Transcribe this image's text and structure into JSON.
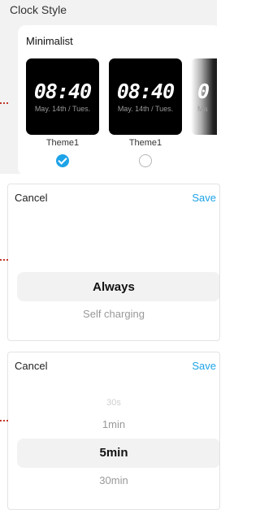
{
  "clock_style": {
    "title": "Clock Style",
    "style_name": "Minimalist",
    "themes": [
      {
        "time": "08:40",
        "date": "May. 14th / Tues.",
        "label": "Theme1",
        "selected": true
      },
      {
        "time": "08:40",
        "date": "May. 14th / Tues.",
        "label": "Theme1",
        "selected": false
      },
      {
        "time": "0",
        "date": "Ma",
        "label": "",
        "selected": false
      }
    ]
  },
  "charging_picker": {
    "cancel": "Cancel",
    "save": "Save",
    "selected": "Always",
    "below": "Self charging"
  },
  "timeout_picker": {
    "cancel": "Cancel",
    "save": "Save",
    "options": [
      "30s",
      "1min",
      "5min",
      "30min"
    ],
    "selected": "5min"
  },
  "colors": {
    "accent": "#1ea3e8",
    "panel_bg": "#f2f2f2",
    "thumb_bg": "#000000"
  }
}
